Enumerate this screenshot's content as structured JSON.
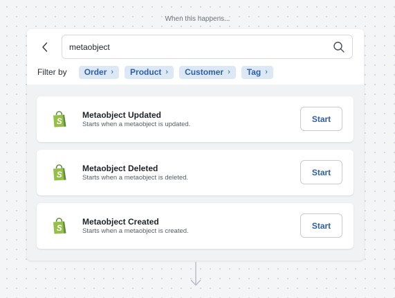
{
  "trigger_caption": "When this happens...",
  "search": {
    "value": "metaobject"
  },
  "filter": {
    "label": "Filter by",
    "chips": [
      {
        "label": "Order"
      },
      {
        "label": "Product"
      },
      {
        "label": "Customer"
      },
      {
        "label": "Tag"
      }
    ]
  },
  "triggers": [
    {
      "title": "Metaobject Updated",
      "description": "Starts when a metaobject is updated.",
      "button": "Start"
    },
    {
      "title": "Metaobject Deleted",
      "description": "Starts when a metaobject is deleted.",
      "button": "Start"
    },
    {
      "title": "Metaobject Created",
      "description": "Starts when a metaobject is created.",
      "button": "Start"
    }
  ],
  "icons": {
    "back": "chevron-left-icon",
    "search": "search-icon",
    "chip_chevron": "chevron-right-icon",
    "app_logo": "shopify-bag-icon",
    "connector": "arrow-down-icon"
  },
  "colors": {
    "accent": "#2f5fa8",
    "chip_bg": "#dde8f6",
    "shopify_green": "#95bf47",
    "shopify_dark_green": "#5e8e3e"
  }
}
